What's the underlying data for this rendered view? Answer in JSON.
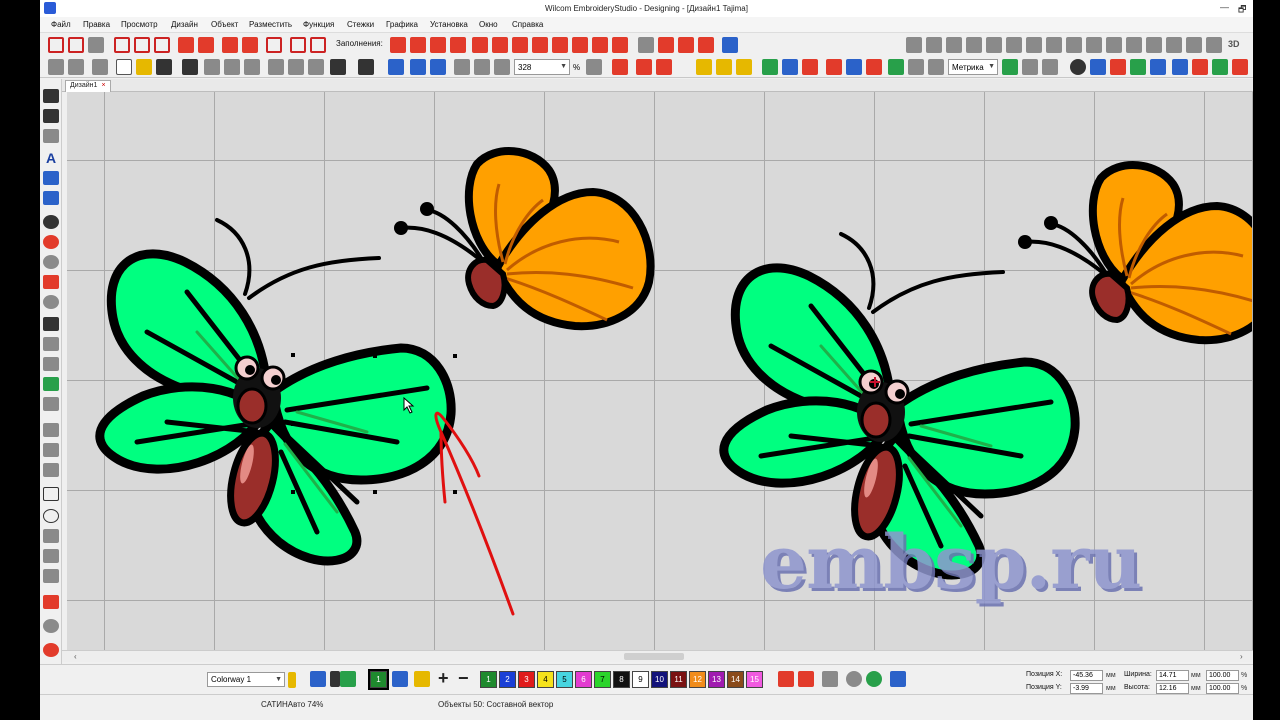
{
  "window": {
    "title": "Wilcom EmbroideryStudio - Designing - [Дизайн1         Tajima]",
    "min_glyph": "—",
    "restore_glyph": "🗗"
  },
  "menu": [
    "Файл",
    "Правка",
    "Просмотр",
    "Дизайн",
    "Объект",
    "Разместить",
    "Функция",
    "Стежки",
    "Графика",
    "Установка",
    "Окно",
    "Справка"
  ],
  "toolbar": {
    "fill_label": "Заполнения:",
    "zoom_value": "328",
    "zoom_unit": "%",
    "units_value": "Метрика",
    "label_3d": "3D"
  },
  "tab": {
    "label": "Дизайн1",
    "close": "×"
  },
  "canvas": {
    "watermark": "embsp.ru"
  },
  "bottom": {
    "colorway": "Colorway 1",
    "swatches": [
      {
        "n": "1",
        "color": "#1f8a2e"
      },
      {
        "n": "2",
        "color": "#1a3fd6"
      },
      {
        "n": "3",
        "color": "#e01b1b"
      },
      {
        "n": "4",
        "color": "#f5e21b"
      },
      {
        "n": "5",
        "color": "#47d5e0"
      },
      {
        "n": "6",
        "color": "#e23bd0"
      },
      {
        "n": "7",
        "color": "#2bd42b"
      },
      {
        "n": "8",
        "color": "#111111"
      },
      {
        "n": "9",
        "color": "#ffffff"
      },
      {
        "n": "10",
        "color": "#12127a"
      },
      {
        "n": "11",
        "color": "#7a1212"
      },
      {
        "n": "12",
        "color": "#f08c1b"
      },
      {
        "n": "13",
        "color": "#a01bb0"
      },
      {
        "n": "14",
        "color": "#8a4b1b"
      },
      {
        "n": "15",
        "color": "#f05ae0"
      }
    ],
    "pos_x_label": "Позиция X:",
    "pos_x": "-45.36",
    "pos_y_label": "Позиция Y:",
    "pos_y": "-3.99",
    "width_label": "Ширина:",
    "width": "14.71",
    "height_label": "Высота:",
    "height": "12.16",
    "unit": "мм",
    "scale_w": "100.00",
    "scale_h": "100.00",
    "pct": "%"
  },
  "status": {
    "left": "САТИНАвто 74%",
    "right": "Объекты 50: Составной вектор"
  },
  "colors": {
    "wing_green": "#00ff80",
    "wing_orange": "#ffa000",
    "body_brown": "#9a2e2a",
    "annotation_red": "#e01010"
  }
}
